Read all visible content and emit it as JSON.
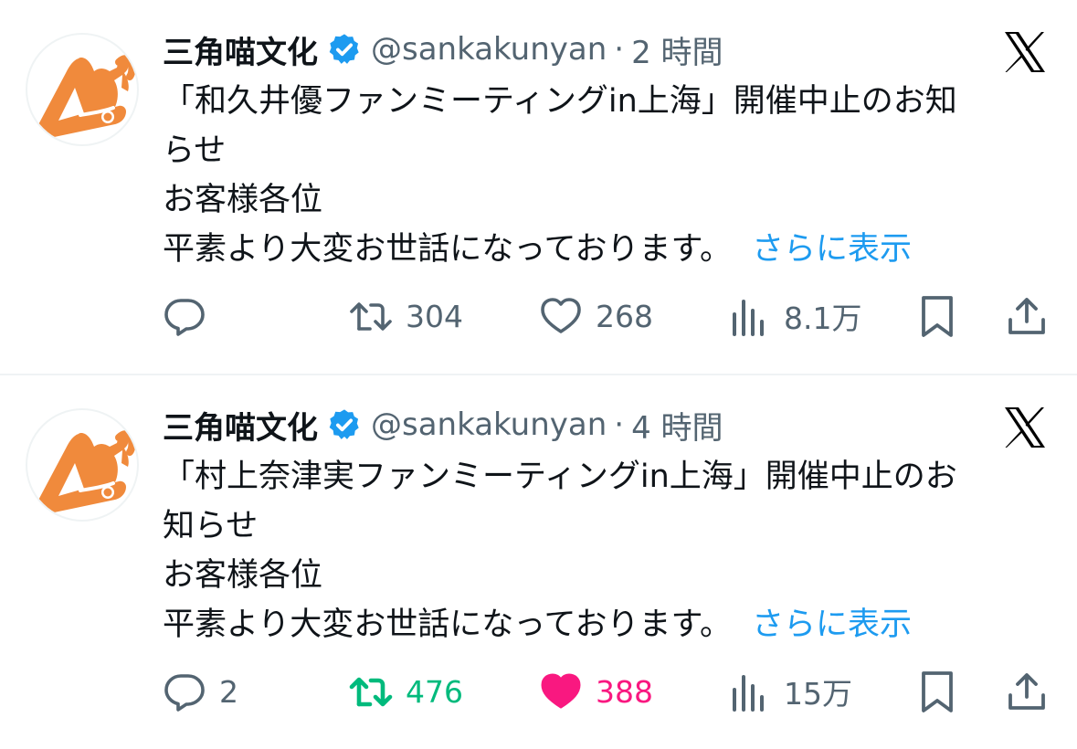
{
  "tweets": [
    {
      "display_name": "三角喵文化",
      "handle": "@sankakunyan",
      "separator": "·",
      "time": "2 時間",
      "lines": [
        "「和久井優ファンミーティングin上海」開催中止のお知",
        "らせ",
        "お客様各位",
        "平素より大変お世話になっております。"
      ],
      "show_more": "さらに表示",
      "replies": "",
      "retweets": "304",
      "likes": "268",
      "views": "8.1万",
      "retweeted": false,
      "liked": false
    },
    {
      "display_name": "三角喵文化",
      "handle": "@sankakunyan",
      "separator": "·",
      "time": "4 時間",
      "lines": [
        "「村上奈津実ファンミーティングin上海」開催中止のお",
        "知らせ",
        "お客様各位",
        "平素より大変お世話になっております。"
      ],
      "show_more": "さらに表示",
      "replies": "2",
      "retweets": "476",
      "likes": "388",
      "views": "15万",
      "retweeted": true,
      "liked": true
    }
  ],
  "colors": {
    "accent": "#1d9bf0",
    "avatar_orange": "#f08a3c",
    "retweet_active": "#00ba7c",
    "like_active": "#f91880",
    "muted": "#536471"
  },
  "icons": {
    "verified": "verified-badge-icon",
    "platform": "x-logo-icon",
    "reply": "reply-bubble-icon",
    "retweet": "retweet-arrows-icon",
    "like": "heart-icon",
    "views": "bar-chart-views-icon",
    "bookmark": "bookmark-icon",
    "share": "share-upload-icon"
  }
}
